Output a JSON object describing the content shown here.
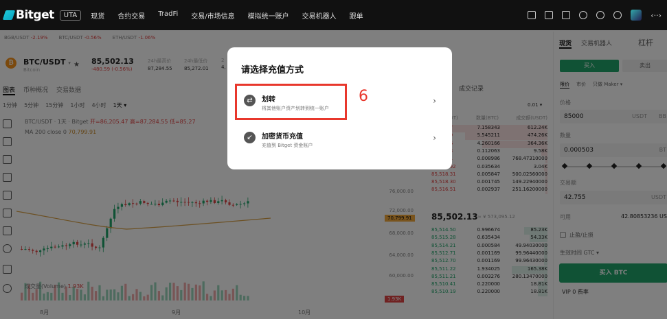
{
  "nav": {
    "brand": "Bitget",
    "badge": "UTA",
    "items": [
      "现货",
      "合约交易",
      "TradFi",
      "交易/市场信息",
      "模拟统一账户",
      "交易机器人",
      "跟单"
    ],
    "icons": [
      "wallet-icon",
      "clock-icon",
      "download-icon",
      "globe-icon",
      "moon-icon",
      "gear-icon",
      "avatar",
      "arrows-icon"
    ]
  },
  "ticker_bar": [
    {
      "pair": "BGB/USDT",
      "change": "-2.19%"
    },
    {
      "pair": "BTC/USDT",
      "change": "-0.56%"
    },
    {
      "pair": "ETH/USDT",
      "change": "-1.06%"
    }
  ],
  "symbol": {
    "coin_letter": "₿",
    "pair": "BTC/USDT",
    "arrow": "▾",
    "name": "Bitcoin",
    "star": "★",
    "price": "85,502.13",
    "change": "-480.59 (-0.56%)",
    "stats": [
      {
        "label": "24h最高价",
        "value": "87,284.55"
      },
      {
        "label": "24h最低价",
        "value": "85,272.01"
      },
      {
        "label": "2",
        "value": "4,"
      }
    ]
  },
  "chart_tabs": [
    "图表",
    "币种概况",
    "交易数据"
  ],
  "chart_tools": [
    "1分钟",
    "5分钟",
    "15分钟",
    "1小时",
    "4小时",
    "1天 ▾"
  ],
  "chart": {
    "ohlc_prefix": "BTC/USDT · 1天 · Bitget",
    "open": "开=86,205.47",
    "high": "高=87,284.55",
    "low": "低=85,27",
    "ma_label": "MA 200 close 0",
    "ma_value": "70,799.91",
    "volume_label": "成交量(Volume)",
    "volume_value": "1.93K",
    "months": [
      "8月",
      "9月",
      "10月"
    ],
    "yaxis": [
      "80,000.00",
      "76,000.00",
      "72,000.00",
      "68,000.00",
      "64,000.00",
      "60,000.00"
    ],
    "ma_tag": "70,799.91",
    "vol_tag": "1.93K"
  },
  "orderbook": {
    "title": "成交记录",
    "step": "0.01 ▾",
    "cols": [
      "价格(USDT)",
      "数量(BTC)",
      "成交额(USDT)"
    ],
    "asks": [
      {
        "p": "85,519.7",
        "q": "7.158343",
        "t": "612.24K",
        "w": 0.9
      },
      {
        "p": "85,519.9",
        "q": "5.545211",
        "t": "474.26K",
        "w": 0.7
      },
      {
        "p": "85,519.6",
        "q": "4.260166",
        "t": "364.36K",
        "w": 0.55
      },
      {
        "p": "85,519.3",
        "q": "0.112063",
        "t": "9.58K",
        "w": 0.05
      },
      {
        "p": "85,519.1",
        "q": "0.008986",
        "t": "768.47310000",
        "w": 0.02
      },
      {
        "p": "85,518.92",
        "q": "0.035634",
        "t": "3.04K",
        "w": 0.03
      },
      {
        "p": "85,518.31",
        "q": "0.005847",
        "t": "500.02560000",
        "w": 0.02
      },
      {
        "p": "85,518.30",
        "q": "0.001745",
        "t": "149.22940000",
        "w": 0.02
      },
      {
        "p": "85,516.51",
        "q": "0.002937",
        "t": "251.16200000",
        "w": 0.02
      }
    ],
    "mid_price": "85,502.13",
    "mid_sub": "≈ ¥ 573,095.12",
    "bids": [
      {
        "p": "85,514.50",
        "q": "0.996674",
        "t": "85.23K",
        "w": 0.2
      },
      {
        "p": "85,515.28",
        "q": "0.635434",
        "t": "54.33K",
        "w": 0.15
      },
      {
        "p": "85,514.21",
        "q": "0.000584",
        "t": "49.94030000",
        "w": 0.03
      },
      {
        "p": "85,512.71",
        "q": "0.001169",
        "t": "99.96440000",
        "w": 0.03
      },
      {
        "p": "85,512.70",
        "q": "0.001169",
        "t": "99.96430000",
        "w": 0.03
      },
      {
        "p": "85,511.22",
        "q": "1.934025",
        "t": "165.38K",
        "w": 0.3
      },
      {
        "p": "85,511.21",
        "q": "0.003276",
        "t": "280.13470000",
        "w": 0.03
      },
      {
        "p": "85,510.41",
        "q": "0.220000",
        "t": "18.81K",
        "w": 0.08
      },
      {
        "p": "85,510.19",
        "q": "0.220000",
        "t": "18.81K",
        "w": 0.08
      }
    ]
  },
  "trade": {
    "tabs": [
      "现货",
      "交易机器人"
    ],
    "leverage": "杠杆",
    "buy_tab": "买入",
    "sell_tab": "卖出",
    "order_types": [
      "限价",
      "市价",
      "只做 Maker ▾"
    ],
    "price_label": "价格",
    "price_value": "85000",
    "price_unit": "USDT",
    "price_cut": "BB",
    "qty_label": "数量",
    "qty_value": "0.000503",
    "qty_cut": "BT",
    "amount_label": "交易额",
    "amount_value": "42.755",
    "amount_unit": "USDT",
    "avail_label": "可用",
    "avail_value": "42.80853236 USDT",
    "tpsl_label": "止盈/止损",
    "tif": "生效时间  GTC ▾",
    "buy_button": "买入 BTC",
    "vip": "VIP 0 费率"
  },
  "modal": {
    "title": "请选择充值方式",
    "options": [
      {
        "icon": "⇄",
        "title": "划转",
        "sub": "将其他账户资产划转到统一账户",
        "chev": "›"
      },
      {
        "icon": "↙",
        "title": "加密货币充值",
        "sub": "充值到 Bitget 资金账户",
        "chev": "›"
      }
    ],
    "step_number": "6"
  },
  "colors": {
    "up": "#20a56b",
    "down": "#e04545",
    "ma": "#d8a045",
    "highlight": "#e8372c"
  }
}
